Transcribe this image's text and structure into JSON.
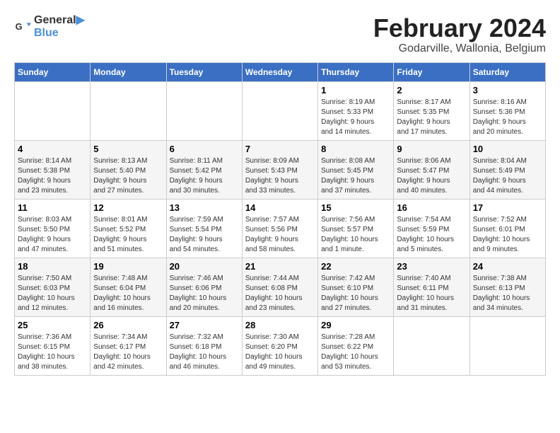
{
  "header": {
    "logo_line1": "General",
    "logo_line2": "Blue",
    "title": "February 2024",
    "subtitle": "Godarville, Wallonia, Belgium"
  },
  "calendar": {
    "days_of_week": [
      "Sunday",
      "Monday",
      "Tuesday",
      "Wednesday",
      "Thursday",
      "Friday",
      "Saturday"
    ],
    "weeks": [
      [
        {
          "day": "",
          "info": ""
        },
        {
          "day": "",
          "info": ""
        },
        {
          "day": "",
          "info": ""
        },
        {
          "day": "",
          "info": ""
        },
        {
          "day": "1",
          "info": "Sunrise: 8:19 AM\nSunset: 5:33 PM\nDaylight: 9 hours\nand 14 minutes."
        },
        {
          "day": "2",
          "info": "Sunrise: 8:17 AM\nSunset: 5:35 PM\nDaylight: 9 hours\nand 17 minutes."
        },
        {
          "day": "3",
          "info": "Sunrise: 8:16 AM\nSunset: 5:36 PM\nDaylight: 9 hours\nand 20 minutes."
        }
      ],
      [
        {
          "day": "4",
          "info": "Sunrise: 8:14 AM\nSunset: 5:38 PM\nDaylight: 9 hours\nand 23 minutes."
        },
        {
          "day": "5",
          "info": "Sunrise: 8:13 AM\nSunset: 5:40 PM\nDaylight: 9 hours\nand 27 minutes."
        },
        {
          "day": "6",
          "info": "Sunrise: 8:11 AM\nSunset: 5:42 PM\nDaylight: 9 hours\nand 30 minutes."
        },
        {
          "day": "7",
          "info": "Sunrise: 8:09 AM\nSunset: 5:43 PM\nDaylight: 9 hours\nand 33 minutes."
        },
        {
          "day": "8",
          "info": "Sunrise: 8:08 AM\nSunset: 5:45 PM\nDaylight: 9 hours\nand 37 minutes."
        },
        {
          "day": "9",
          "info": "Sunrise: 8:06 AM\nSunset: 5:47 PM\nDaylight: 9 hours\nand 40 minutes."
        },
        {
          "day": "10",
          "info": "Sunrise: 8:04 AM\nSunset: 5:49 PM\nDaylight: 9 hours\nand 44 minutes."
        }
      ],
      [
        {
          "day": "11",
          "info": "Sunrise: 8:03 AM\nSunset: 5:50 PM\nDaylight: 9 hours\nand 47 minutes."
        },
        {
          "day": "12",
          "info": "Sunrise: 8:01 AM\nSunset: 5:52 PM\nDaylight: 9 hours\nand 51 minutes."
        },
        {
          "day": "13",
          "info": "Sunrise: 7:59 AM\nSunset: 5:54 PM\nDaylight: 9 hours\nand 54 minutes."
        },
        {
          "day": "14",
          "info": "Sunrise: 7:57 AM\nSunset: 5:56 PM\nDaylight: 9 hours\nand 58 minutes."
        },
        {
          "day": "15",
          "info": "Sunrise: 7:56 AM\nSunset: 5:57 PM\nDaylight: 10 hours\nand 1 minute."
        },
        {
          "day": "16",
          "info": "Sunrise: 7:54 AM\nSunset: 5:59 PM\nDaylight: 10 hours\nand 5 minutes."
        },
        {
          "day": "17",
          "info": "Sunrise: 7:52 AM\nSunset: 6:01 PM\nDaylight: 10 hours\nand 9 minutes."
        }
      ],
      [
        {
          "day": "18",
          "info": "Sunrise: 7:50 AM\nSunset: 6:03 PM\nDaylight: 10 hours\nand 12 minutes."
        },
        {
          "day": "19",
          "info": "Sunrise: 7:48 AM\nSunset: 6:04 PM\nDaylight: 10 hours\nand 16 minutes."
        },
        {
          "day": "20",
          "info": "Sunrise: 7:46 AM\nSunset: 6:06 PM\nDaylight: 10 hours\nand 20 minutes."
        },
        {
          "day": "21",
          "info": "Sunrise: 7:44 AM\nSunset: 6:08 PM\nDaylight: 10 hours\nand 23 minutes."
        },
        {
          "day": "22",
          "info": "Sunrise: 7:42 AM\nSunset: 6:10 PM\nDaylight: 10 hours\nand 27 minutes."
        },
        {
          "day": "23",
          "info": "Sunrise: 7:40 AM\nSunset: 6:11 PM\nDaylight: 10 hours\nand 31 minutes."
        },
        {
          "day": "24",
          "info": "Sunrise: 7:38 AM\nSunset: 6:13 PM\nDaylight: 10 hours\nand 34 minutes."
        }
      ],
      [
        {
          "day": "25",
          "info": "Sunrise: 7:36 AM\nSunset: 6:15 PM\nDaylight: 10 hours\nand 38 minutes."
        },
        {
          "day": "26",
          "info": "Sunrise: 7:34 AM\nSunset: 6:17 PM\nDaylight: 10 hours\nand 42 minutes."
        },
        {
          "day": "27",
          "info": "Sunrise: 7:32 AM\nSunset: 6:18 PM\nDaylight: 10 hours\nand 46 minutes."
        },
        {
          "day": "28",
          "info": "Sunrise: 7:30 AM\nSunset: 6:20 PM\nDaylight: 10 hours\nand 49 minutes."
        },
        {
          "day": "29",
          "info": "Sunrise: 7:28 AM\nSunset: 6:22 PM\nDaylight: 10 hours\nand 53 minutes."
        },
        {
          "day": "",
          "info": ""
        },
        {
          "day": "",
          "info": ""
        }
      ]
    ]
  }
}
